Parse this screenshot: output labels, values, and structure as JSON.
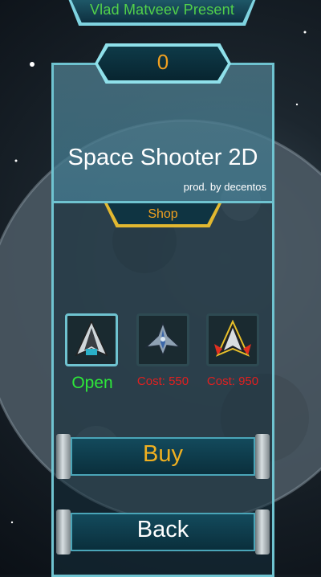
{
  "header": {
    "banner_text": "Vlad Matveev Present"
  },
  "score": {
    "value": "0"
  },
  "title": {
    "main": "Space Shooter 2D",
    "credit": "prod. by decentos"
  },
  "shop": {
    "tab_label": "Shop"
  },
  "ships": [
    {
      "label": "Open",
      "status": "open",
      "selected": true
    },
    {
      "label": "Cost: 550",
      "status": "locked",
      "selected": false
    },
    {
      "label": "Cost: 950",
      "status": "locked",
      "selected": false
    }
  ],
  "buttons": {
    "buy_label": "Buy",
    "back_label": "Back"
  },
  "colors": {
    "accent_green": "#2ee83a",
    "price_red": "#e02020",
    "gold": "#f0a020",
    "panel_border": "#6fc3d0"
  }
}
